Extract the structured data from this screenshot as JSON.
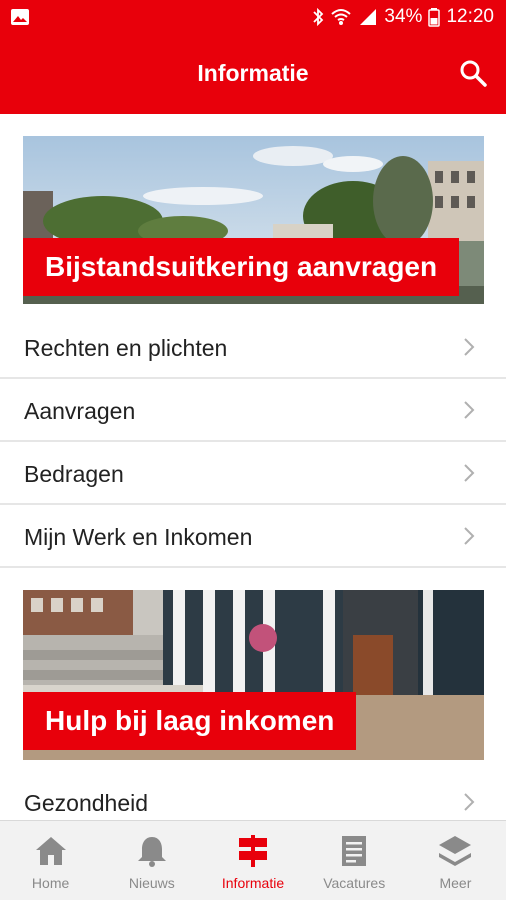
{
  "status_bar": {
    "battery": "34%",
    "time": "12:20"
  },
  "app_bar": {
    "title": "Informatie"
  },
  "banners": [
    {
      "label": "Bijstandsuitkering aanvragen"
    },
    {
      "label": "Hulp bij laag inkomen"
    }
  ],
  "list_group_1": [
    {
      "label": "Rechten en plichten"
    },
    {
      "label": "Aanvragen"
    },
    {
      "label": "Bedragen"
    },
    {
      "label": "Mijn Werk en Inkomen"
    }
  ],
  "list_group_2": [
    {
      "label": "Gezondheid"
    }
  ],
  "bottom_nav": [
    {
      "label": "Home",
      "icon": "home-icon"
    },
    {
      "label": "Nieuws",
      "icon": "bell-icon"
    },
    {
      "label": "Informatie",
      "icon": "signpost-icon",
      "active": true
    },
    {
      "label": "Vacatures",
      "icon": "document-icon"
    },
    {
      "label": "Meer",
      "icon": "layers-icon"
    }
  ],
  "colors": {
    "brand": "#e8000b",
    "nav_inactive": "#8a8a8a",
    "divider": "#e6e6e6"
  }
}
